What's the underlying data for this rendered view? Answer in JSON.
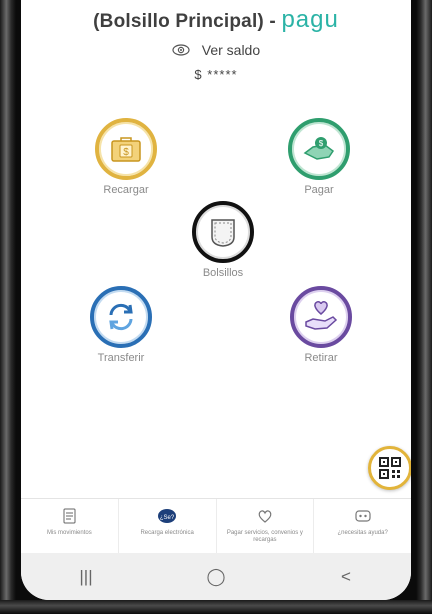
{
  "header": {
    "title": "(Bolsillo Principal) -",
    "brand": "pagu",
    "ver_saldo": "Ver saldo",
    "saldo": "$ *****"
  },
  "actions": {
    "recargar": "Recargar",
    "pagar": "Pagar",
    "bolsillos": "Bolsillos",
    "transferir": "Transferir",
    "retirar": "Retirar"
  },
  "colors": {
    "recargar": "#e0b340",
    "pagar": "#2f9e6e",
    "bolsillos": "#111111",
    "transferir": "#2a6fb5",
    "retirar": "#6a4aa0",
    "brand": "#2bb3a6"
  },
  "bottom_nav": {
    "items": [
      {
        "label": "Mis movimientos",
        "icon": "document-icon"
      },
      {
        "label": "Recarga electrónica",
        "icon": "recharge-icon"
      },
      {
        "label": "Pagar servicios, convenios y recargas",
        "icon": "pay-heart-icon"
      },
      {
        "label": "¿necesitas ayuda?",
        "icon": "help-icon"
      }
    ]
  },
  "android_nav": {
    "recents": "|||",
    "home": "◯",
    "back": "<"
  }
}
